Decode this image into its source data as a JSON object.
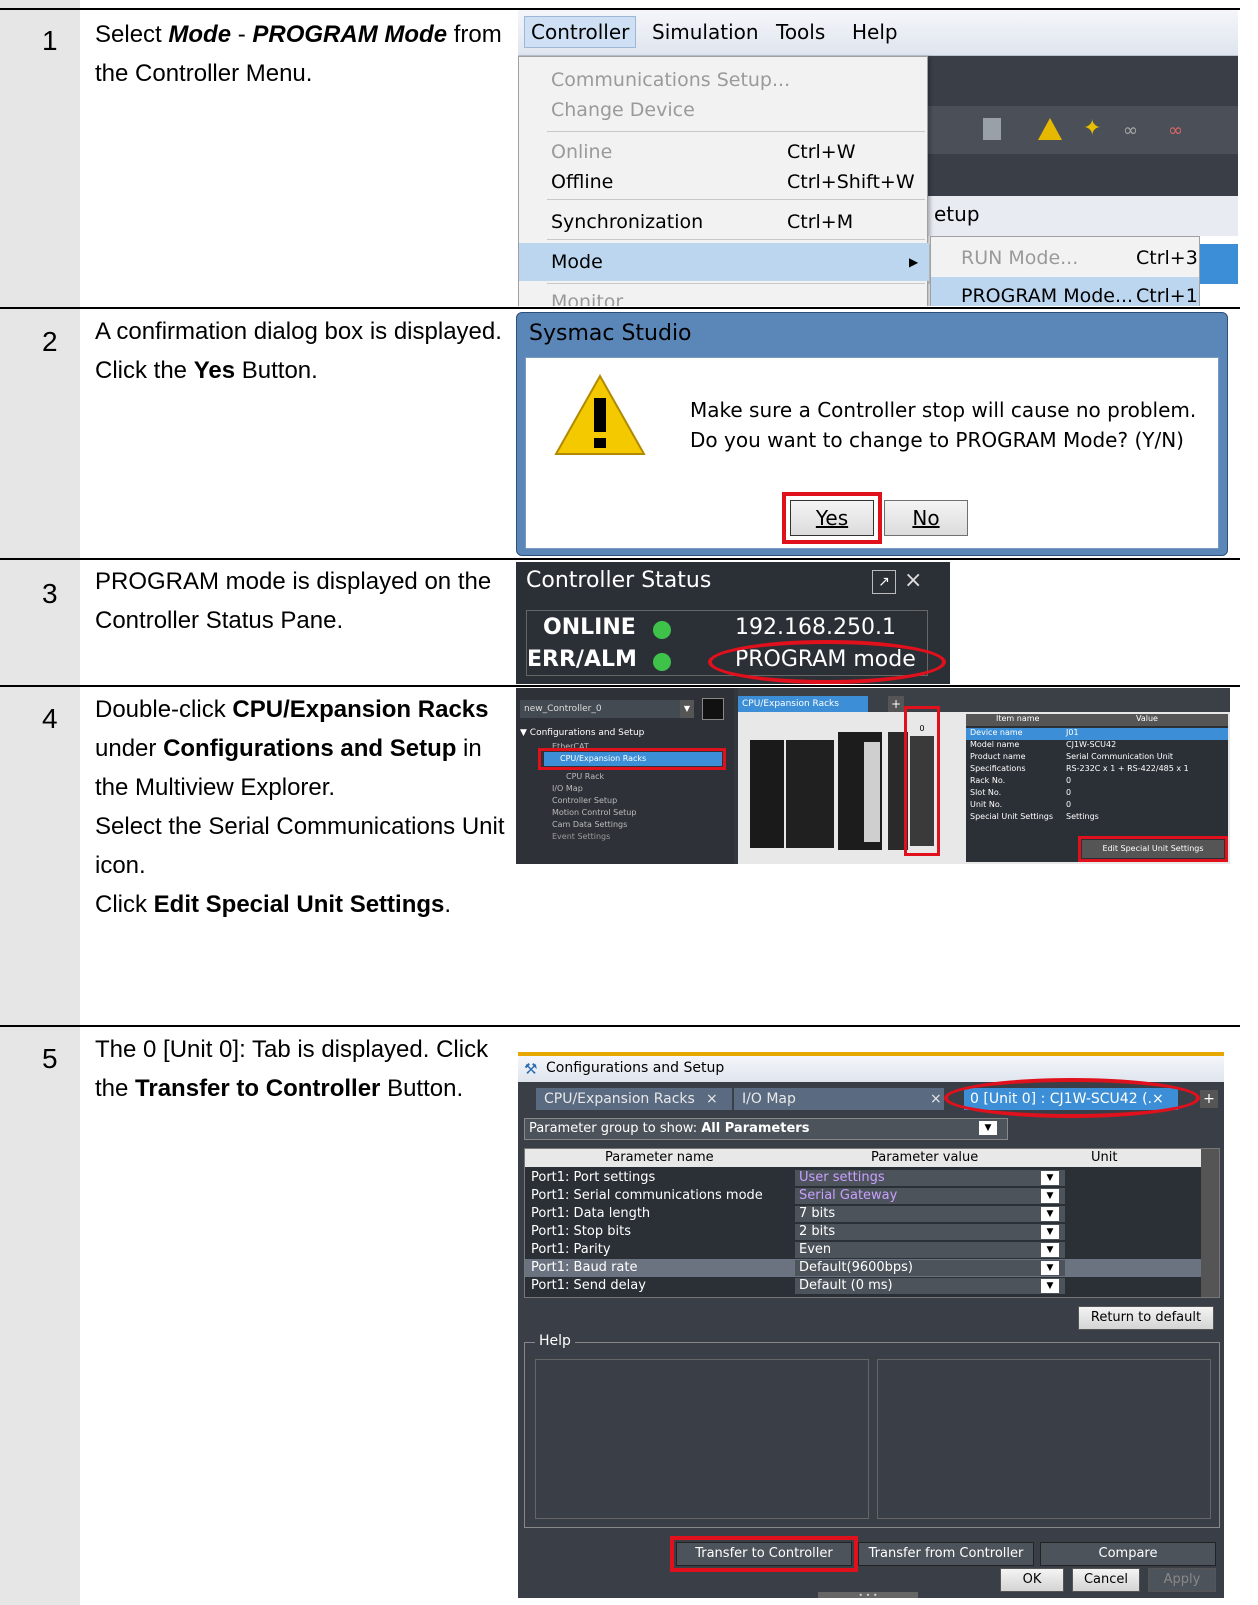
{
  "steps": [
    {
      "number": "1",
      "text_parts": [
        "Select ",
        "Mode",
        " - ",
        "PROGRAM Mode",
        " from the Controller Menu."
      ]
    },
    {
      "number": "2",
      "text_parts": [
        "A confirmation dialog box is displayed. Click the ",
        "Yes",
        " Button."
      ]
    },
    {
      "number": "3",
      "text_parts": [
        "PROGRAM mode is displayed on the Controller Status Pane."
      ]
    },
    {
      "number": "4",
      "text_parts": [
        "Double-click ",
        "CPU/Expansion Racks",
        " under ",
        "Configurations and Setup",
        " in the Multiview Explorer.",
        "Select the Serial Communications Unit icon.",
        "Click ",
        "Edit Special Unit Settings",
        "."
      ]
    },
    {
      "number": "5",
      "text_parts": [
        "The 0 [Unit 0]: Tab is displayed. Click the ",
        "Transfer to Controller",
        " Button."
      ]
    }
  ],
  "menu": {
    "bar": [
      "Controller",
      "Simulation",
      "Tools",
      "Help"
    ],
    "items": [
      {
        "label": "Communications Setup...",
        "shortcut": "",
        "disabled": true
      },
      {
        "label": "Change Device",
        "shortcut": "",
        "disabled": true
      },
      {
        "label": "Online",
        "shortcut": "Ctrl+W",
        "disabled": true
      },
      {
        "label": "Offline",
        "shortcut": "Ctrl+Shift+W",
        "disabled": false
      },
      {
        "label": "Synchronization",
        "shortcut": "Ctrl+M",
        "disabled": false
      },
      {
        "label": "Mode",
        "shortcut": "",
        "disabled": false
      },
      {
        "label": "Monitor",
        "shortcut": "",
        "disabled": true
      }
    ],
    "submenu": [
      {
        "label": "RUN Mode...",
        "shortcut": "Ctrl+3",
        "disabled": true
      },
      {
        "label": "PROGRAM Mode...",
        "shortcut": "Ctrl+1",
        "disabled": false
      }
    ],
    "background_fragment": "etup"
  },
  "dialog": {
    "title": "Sysmac Studio",
    "message_line1": "Make sure a Controller stop will cause no problem.",
    "message_line2": "Do you want to change to PROGRAM Mode? (Y/N)",
    "yes": "Yes",
    "no": "No"
  },
  "status": {
    "title": "Controller Status",
    "online_label": "ONLINE",
    "online_value": "192.168.250.1",
    "err_label": "ERR/ALM",
    "err_value": "PROGRAM mode",
    "led_color": "#3ec24a"
  },
  "explorer": {
    "controller": "new_Controller_0",
    "tree": [
      "Configurations and Setup",
      "EtherCAT",
      "CPU/Expansion Racks",
      "CPU Rack",
      "I/O Map",
      "Controller Setup",
      "Motion Control Setup",
      "Cam Data Settings",
      "Event Settings"
    ],
    "tab": "CPU/Expansion Racks",
    "slot_label": "0",
    "props_headers": [
      "Item name",
      "Value"
    ],
    "props": [
      [
        "Device name",
        "J01"
      ],
      [
        "Model name",
        "CJ1W-SCU42"
      ],
      [
        "Product name",
        "Serial Communication Unit"
      ],
      [
        "Specifications",
        "RS-232C x 1 + RS-422/485 x 1"
      ],
      [
        "Rack No.",
        "0"
      ],
      [
        "Slot No.",
        "0"
      ],
      [
        "Unit No.",
        "0"
      ],
      [
        "Special Unit Settings",
        "Settings"
      ]
    ],
    "edit_button": "Edit Special Unit Settings"
  },
  "config": {
    "title": "Configurations and Setup",
    "tabs": [
      "CPU/Expansion Racks",
      "I/O Map",
      "0 [Unit 0] : CJ1W-SCU42 (.×"
    ],
    "param_group_label": "Parameter group to show:",
    "param_group_value": "All Parameters",
    "headers": [
      "Parameter name",
      "Parameter value",
      "Unit"
    ],
    "rows": [
      [
        "Port1: Port settings",
        "User settings"
      ],
      [
        "Port1: Serial communications mode",
        "Serial Gateway"
      ],
      [
        "Port1: Data length",
        "7 bits"
      ],
      [
        "Port1: Stop bits",
        "2 bits"
      ],
      [
        "Port1: Parity",
        "Even"
      ],
      [
        "Port1: Baud rate",
        "Default(9600bps)"
      ],
      [
        "Port1: Send delay",
        "Default (0 ms)"
      ]
    ],
    "return_default": "Return to default",
    "help": "Help",
    "transfer_to": "Transfer to Controller",
    "transfer_from": "Transfer from Controller",
    "compare": "Compare",
    "ok": "OK",
    "cancel": "Cancel",
    "apply": "Apply"
  },
  "colors": {
    "highlight_red": "#e0101c",
    "gutter": "#e6e6e6",
    "sysmac_dark": "#2b2f36"
  }
}
